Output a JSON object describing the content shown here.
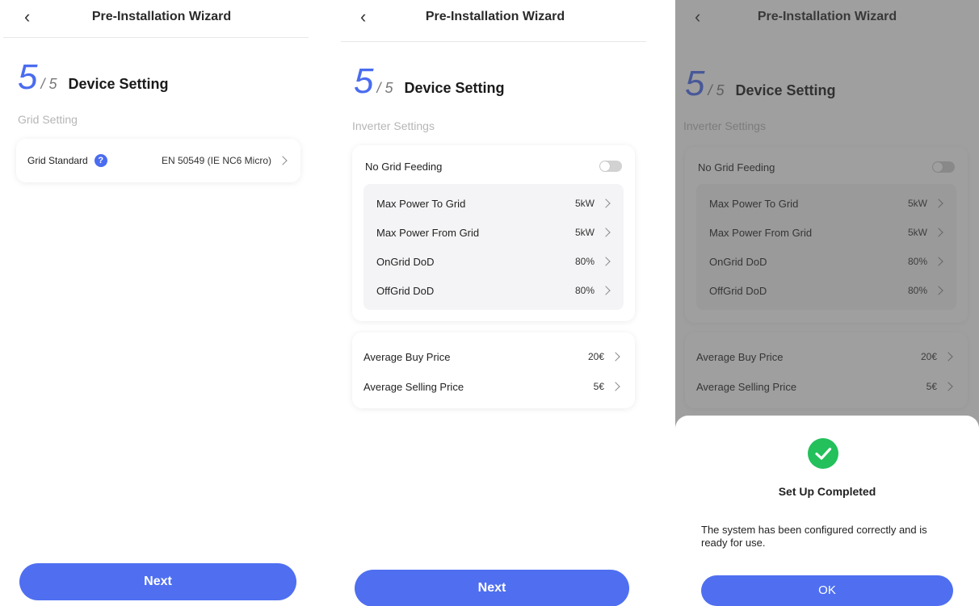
{
  "header": {
    "title": "Pre-Installation Wizard",
    "back_icon": "chevron-left-icon"
  },
  "step": {
    "current": "5",
    "total": "/ 5",
    "heading": "Device Setting"
  },
  "screen1": {
    "section": "Grid Setting",
    "grid_standard": {
      "label": "Grid Standard",
      "info_icon": "?",
      "value": "EN 50549 (IE NC6 Micro)"
    },
    "button": "Next"
  },
  "screen2": {
    "section": "Inverter Settings",
    "no_grid_feeding": {
      "label": "No Grid Feeding",
      "enabled": false
    },
    "limits": [
      {
        "label": "Max Power To Grid",
        "value": "5kW"
      },
      {
        "label": "Max Power From Grid",
        "value": "5kW"
      },
      {
        "label": "OnGrid DoD",
        "value": "80%"
      },
      {
        "label": "OffGrid DoD",
        "value": "80%"
      }
    ],
    "prices": [
      {
        "label": "Average  Buy Price",
        "value": "20€"
      },
      {
        "label": "Average Selling Price",
        "value": "5€"
      }
    ],
    "button": "Next"
  },
  "dialog": {
    "title": "Set Up Completed",
    "message": "The system has been configured correctly and is ready for use.",
    "button": "OK",
    "icon": "check-circle-icon"
  },
  "colors": {
    "accent": "#4f6ff0",
    "success": "#23c05b",
    "muted": "#b6b6b6"
  }
}
